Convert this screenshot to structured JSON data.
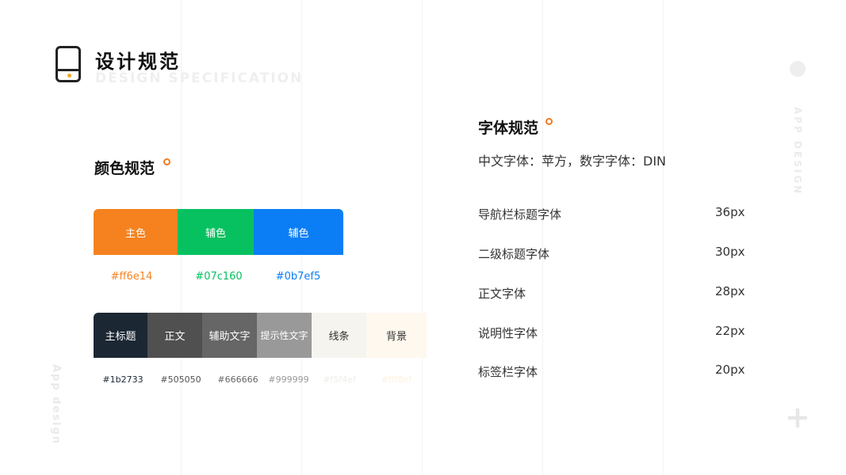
{
  "header": {
    "title": "设计规范",
    "subtitle": "DESIGN SPECIFICATION"
  },
  "decor": {
    "side_left": "App design",
    "side_right": "APP DESIGN",
    "plus": "+"
  },
  "colors": {
    "section_title": "颜色规范",
    "primary": [
      {
        "label": "主色",
        "hex": "#ff6e14",
        "color": "#f5821f"
      },
      {
        "label": "辅色",
        "hex": "#07c160",
        "color": "#07c160"
      },
      {
        "label": "辅色",
        "hex": "#0b7ef5",
        "color": "#0b7ef5"
      }
    ],
    "neutral": [
      {
        "label": "主标题",
        "hex": "#1b2733",
        "color": "#1b2733"
      },
      {
        "label": "正文",
        "hex": "#505050",
        "color": "#505050"
      },
      {
        "label": "辅助文字",
        "hex": "#666666",
        "color": "#666666"
      },
      {
        "label": "提示性文字",
        "hex": "#999999",
        "color": "#999999"
      },
      {
        "label": "线条",
        "hex": "#f5f4ef",
        "color": "#f5f4ef"
      },
      {
        "label": "背景",
        "hex": "#fff8ef",
        "color": "#fff8ef"
      }
    ]
  },
  "fonts": {
    "section_title": "字体规范",
    "description": "中文字体：苹方，数字字体：DIN",
    "items": [
      {
        "name": "导航栏标题字体",
        "size": "36px"
      },
      {
        "name": "二级标题字体",
        "size": "30px"
      },
      {
        "name": "正文字体",
        "size": "28px"
      },
      {
        "name": "说明性字体",
        "size": "22px"
      },
      {
        "name": "标签栏字体",
        "size": "20px"
      }
    ]
  }
}
